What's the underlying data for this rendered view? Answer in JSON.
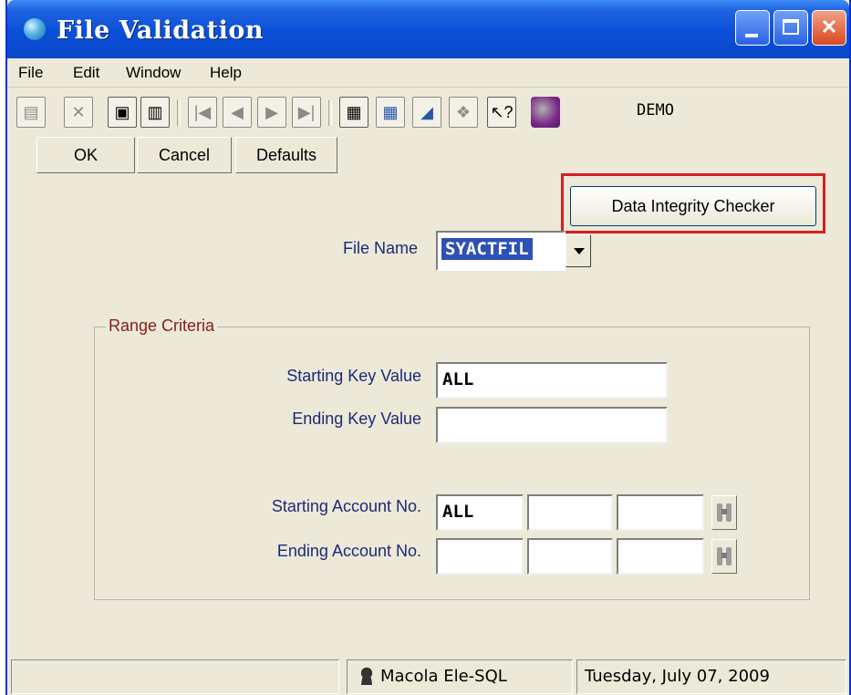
{
  "window": {
    "title": "File Validation",
    "controls": {
      "minimize": "minimize",
      "maximize": "maximize",
      "close": "close"
    }
  },
  "menu": [
    "File",
    "Edit",
    "Window",
    "Help"
  ],
  "toolbar": {
    "company": "DEMO",
    "icons": [
      "new-icon",
      "delete-x-icon",
      "save-icon",
      "trash-icon",
      "first-record-icon",
      "previous-record-icon",
      "next-record-icon",
      "last-record-icon",
      "notes-icon",
      "calculator-icon",
      "chart-icon",
      "network-icon",
      "help-pointer-icon",
      "globe-icon"
    ]
  },
  "buttons": {
    "ok": "OK",
    "cancel": "Cancel",
    "defaults": "Defaults",
    "data_integrity": "Data Integrity Checker"
  },
  "file_name": {
    "label": "File Name",
    "value": "SYACTFIL"
  },
  "range": {
    "title": "Range Criteria",
    "starting_key_label": "Starting Key Value",
    "starting_key_value": "ALL",
    "ending_key_label": "Ending Key Value",
    "ending_key_value": "",
    "starting_account_label": "Starting Account No.",
    "starting_account_value": "ALL",
    "ending_account_label": "Ending Account No.",
    "ending_account_value": ""
  },
  "status": {
    "server": "Macola Ele-SQL",
    "date": "Tuesday, July 07, 2009"
  },
  "colors": {
    "title_bar": "#0a4fd8",
    "label_text": "#1c2a78",
    "group_title": "#8b1a1a",
    "highlight": "#d62020"
  }
}
